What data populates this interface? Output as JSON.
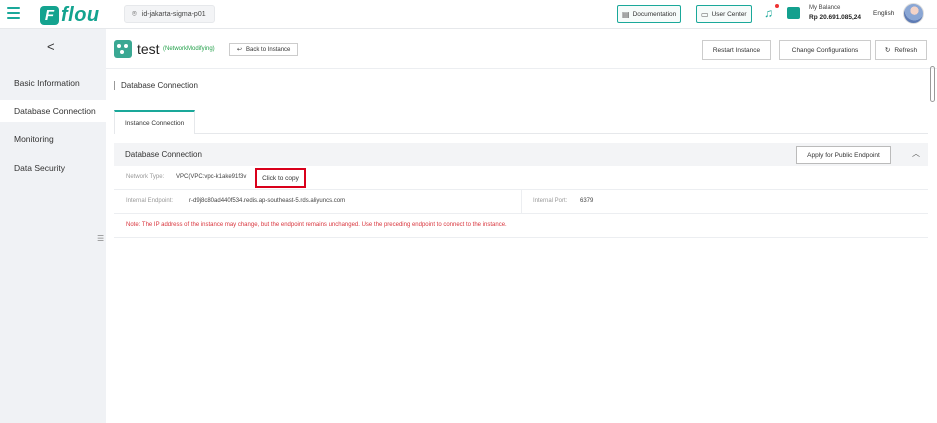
{
  "topbar": {
    "logo_mark": "F",
    "logo_text": "flou",
    "region": "id-jakarta-sigma-p01",
    "documentation": "Documentation",
    "user_center": "User Center",
    "balance_label": "My Balance",
    "balance_value": "Rp 20.691.085,24",
    "language": "English"
  },
  "sidebar": {
    "back": "<",
    "items": [
      {
        "label": "Basic Information"
      },
      {
        "label": "Database Connection"
      },
      {
        "label": "Monitoring"
      },
      {
        "label": "Data Security"
      }
    ]
  },
  "header": {
    "instance_name": "test",
    "status": "(NetworkModifying)",
    "back_label": "Back to Instance",
    "restart": "Restart Instance",
    "change_config": "Change Configurations",
    "refresh": "Refresh"
  },
  "main": {
    "section_title": "Database Connection",
    "tab": "Instance Connection",
    "panel_title": "Database Connection",
    "apply_public": "Apply for Public Endpoint",
    "network_type_label": "Network Type:",
    "network_type_value": "VPC(VPC:vpc-k1ake91f3v",
    "copy_label": "Click to copy",
    "endpoint_label": "Internal Endpoint:",
    "endpoint_value": "r-d9j8c80ad440f534.redis.ap-southeast-5.rds.aliyuncs.com",
    "port_label": "Internal Port:",
    "port_value": "6379",
    "note": "Note:  The IP address of the instance may change, but the endpoint remains unchanged. Use the preceding endpoint to connect to the instance."
  }
}
